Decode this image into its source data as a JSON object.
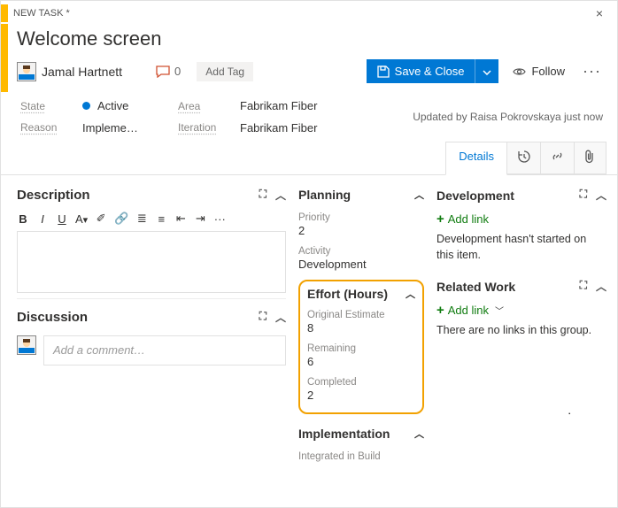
{
  "header": {
    "type_label": "NEW TASK *",
    "title": "Welcome screen",
    "assignee": "Jamal Hartnett",
    "comment_count": "0",
    "add_tag": "Add Tag",
    "save_label": "Save & Close",
    "follow_label": "Follow"
  },
  "meta": {
    "state_label": "State",
    "state_value": "Active",
    "reason_label": "Reason",
    "reason_value": "Impleme…",
    "area_label": "Area",
    "area_value": "Fabrikam Fiber",
    "iteration_label": "Iteration",
    "iteration_value": "Fabrikam Fiber",
    "updated": "Updated by Raisa Pokrovskaya  just now"
  },
  "tabs": {
    "details": "Details"
  },
  "left": {
    "description_hdr": "Description",
    "discussion_hdr": "Discussion",
    "comment_placeholder": "Add a comment…"
  },
  "planning": {
    "hdr": "Planning",
    "priority_label": "Priority",
    "priority_value": "2",
    "activity_label": "Activity",
    "activity_value": "Development"
  },
  "effort": {
    "hdr": "Effort (Hours)",
    "orig_label": "Original Estimate",
    "orig_value": "8",
    "rem_label": "Remaining",
    "rem_value": "6",
    "comp_label": "Completed",
    "comp_value": "2"
  },
  "impl": {
    "hdr": "Implementation",
    "field_label": "Integrated in Build"
  },
  "dev": {
    "hdr": "Development",
    "add_link": "Add link",
    "text": "Development hasn't started on this item."
  },
  "related": {
    "hdr": "Related Work",
    "add_link": "Add link",
    "text": "There are no links in this group."
  }
}
